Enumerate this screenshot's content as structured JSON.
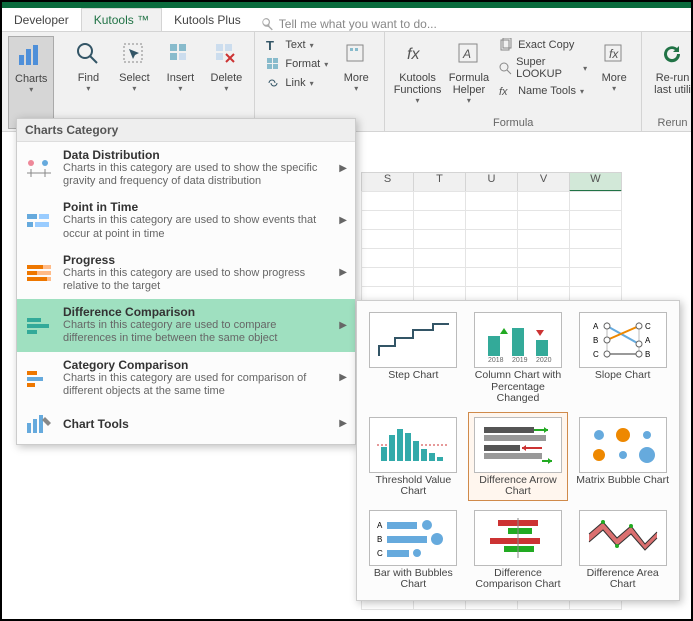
{
  "tabs": {
    "developer": "Developer",
    "kutools": "Kutools ™",
    "kutoolsplus": "Kutools Plus"
  },
  "tellme": "Tell me what you want to do...",
  "ribbon": {
    "charts": "Charts",
    "find": "Find",
    "select": "Select",
    "insert": "Insert",
    "delete": "Delete",
    "text": "Text",
    "format": "Format",
    "link": "Link",
    "more": "More",
    "kutoolsfn": "Kutools\nFunctions",
    "formulahelper": "Formula\nHelper",
    "exactcopy": "Exact Copy",
    "superlookup": "Super LOOKUP",
    "nametools": "Name Tools",
    "more2": "More",
    "rerun": "Re-run\nlast utili",
    "grp_formula": "Formula",
    "grp_rerun": "Rerun"
  },
  "menu": {
    "header": "Charts Category",
    "items": [
      {
        "title": "Data Distribution",
        "desc": "Charts in this category are used to show the specific gravity and frequency of data distribution"
      },
      {
        "title": "Point in Time",
        "desc": "Charts in this category are used to show events that occur at point in time"
      },
      {
        "title": "Progress",
        "desc": "Charts in this category are used to show progress relative to the target"
      },
      {
        "title": "Difference Comparison",
        "desc": "Charts in this category are used to compare differences in time between the same object"
      },
      {
        "title": "Category Comparison",
        "desc": "Charts in this category are used for comparison of different objects at the same time"
      },
      {
        "title": "Chart Tools",
        "desc": ""
      }
    ]
  },
  "gallery": [
    "Step Chart",
    "Column Chart with Percentage Changed",
    "Slope Chart",
    "Threshold Value Chart",
    "Difference Arrow Chart",
    "Matrix Bubble Chart",
    "Bar with Bubbles Chart",
    "Difference Comparison Chart",
    "Difference Area Chart"
  ],
  "columns": [
    "S",
    "T",
    "U",
    "V",
    "W"
  ]
}
